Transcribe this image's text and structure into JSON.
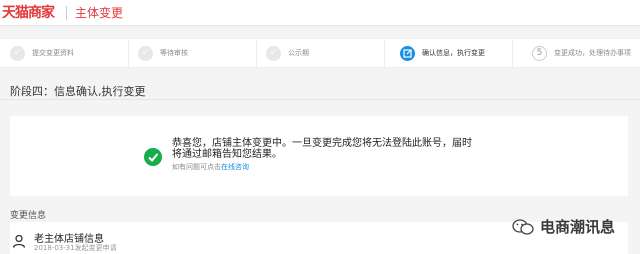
{
  "header": {
    "logo": "天猫商家",
    "title": "主体变更"
  },
  "steps": [
    {
      "label": "提交变更资料",
      "icon": "check",
      "status": "done"
    },
    {
      "label": "等待审核",
      "icon": "check",
      "status": "done"
    },
    {
      "label": "公示期",
      "icon": "check",
      "status": "done"
    },
    {
      "label": "确认信息，执行变更",
      "icon": "edit",
      "status": "active"
    },
    {
      "label": "变更成功，处理待办事项",
      "number": "5",
      "status": "todo"
    }
  ],
  "stage": {
    "title": "阶段四：信息确认,执行变更"
  },
  "result": {
    "message": "恭喜您，店铺主体变更中。一旦变更完成您将无法登陆此账号，届时将通过邮箱告知您结果。",
    "sub_prefix": "如有问题可点击",
    "sub_link": "在线咨询"
  },
  "change_info": {
    "section_title": "变更信息",
    "item_title": "老主体店铺信息",
    "item_date": "2018-03-31发起变更申请"
  },
  "watermark": {
    "text": "电商潮讯息"
  },
  "colors": {
    "brand": "#e4393c",
    "accent": "#1a8fe3",
    "success": "#18ad4c"
  }
}
